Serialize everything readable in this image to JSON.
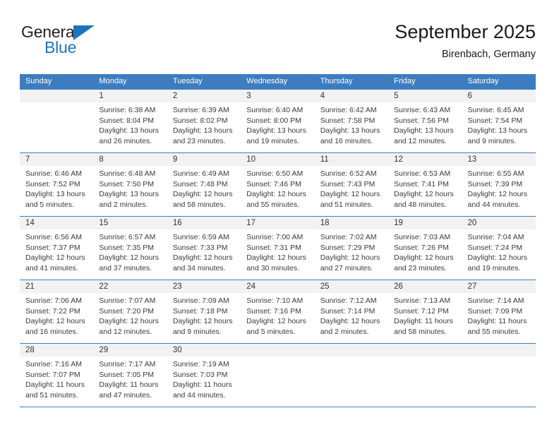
{
  "brand": {
    "name_part1": "General",
    "name_part2": "Blue",
    "accent_color": "#1b75bb"
  },
  "header": {
    "title": "September 2025",
    "subtitle": "Birenbach, Germany"
  },
  "calendar": {
    "header_bg": "#3d7dbf",
    "daynum_bg": "#f2f2f2",
    "labels": {
      "sunrise": "Sunrise:",
      "sunset": "Sunset:",
      "daylight": "Daylight:"
    },
    "weekdays": [
      "Sunday",
      "Monday",
      "Tuesday",
      "Wednesday",
      "Thursday",
      "Friday",
      "Saturday"
    ],
    "weeks": [
      [
        {
          "empty": true
        },
        {
          "day": "1",
          "sunrise": "Sunrise: 6:38 AM",
          "sunset": "Sunset: 8:04 PM",
          "daylight_line1": "Daylight: 13 hours",
          "daylight_line2": "and 26 minutes."
        },
        {
          "day": "2",
          "sunrise": "Sunrise: 6:39 AM",
          "sunset": "Sunset: 8:02 PM",
          "daylight_line1": "Daylight: 13 hours",
          "daylight_line2": "and 23 minutes."
        },
        {
          "day": "3",
          "sunrise": "Sunrise: 6:40 AM",
          "sunset": "Sunset: 8:00 PM",
          "daylight_line1": "Daylight: 13 hours",
          "daylight_line2": "and 19 minutes."
        },
        {
          "day": "4",
          "sunrise": "Sunrise: 6:42 AM",
          "sunset": "Sunset: 7:58 PM",
          "daylight_line1": "Daylight: 13 hours",
          "daylight_line2": "and 16 minutes."
        },
        {
          "day": "5",
          "sunrise": "Sunrise: 6:43 AM",
          "sunset": "Sunset: 7:56 PM",
          "daylight_line1": "Daylight: 13 hours",
          "daylight_line2": "and 12 minutes."
        },
        {
          "day": "6",
          "sunrise": "Sunrise: 6:45 AM",
          "sunset": "Sunset: 7:54 PM",
          "daylight_line1": "Daylight: 13 hours",
          "daylight_line2": "and 9 minutes."
        }
      ],
      [
        {
          "day": "7",
          "sunrise": "Sunrise: 6:46 AM",
          "sunset": "Sunset: 7:52 PM",
          "daylight_line1": "Daylight: 13 hours",
          "daylight_line2": "and 5 minutes."
        },
        {
          "day": "8",
          "sunrise": "Sunrise: 6:48 AM",
          "sunset": "Sunset: 7:50 PM",
          "daylight_line1": "Daylight: 13 hours",
          "daylight_line2": "and 2 minutes."
        },
        {
          "day": "9",
          "sunrise": "Sunrise: 6:49 AM",
          "sunset": "Sunset: 7:48 PM",
          "daylight_line1": "Daylight: 12 hours",
          "daylight_line2": "and 58 minutes."
        },
        {
          "day": "10",
          "sunrise": "Sunrise: 6:50 AM",
          "sunset": "Sunset: 7:46 PM",
          "daylight_line1": "Daylight: 12 hours",
          "daylight_line2": "and 55 minutes."
        },
        {
          "day": "11",
          "sunrise": "Sunrise: 6:52 AM",
          "sunset": "Sunset: 7:43 PM",
          "daylight_line1": "Daylight: 12 hours",
          "daylight_line2": "and 51 minutes."
        },
        {
          "day": "12",
          "sunrise": "Sunrise: 6:53 AM",
          "sunset": "Sunset: 7:41 PM",
          "daylight_line1": "Daylight: 12 hours",
          "daylight_line2": "and 48 minutes."
        },
        {
          "day": "13",
          "sunrise": "Sunrise: 6:55 AM",
          "sunset": "Sunset: 7:39 PM",
          "daylight_line1": "Daylight: 12 hours",
          "daylight_line2": "and 44 minutes."
        }
      ],
      [
        {
          "day": "14",
          "sunrise": "Sunrise: 6:56 AM",
          "sunset": "Sunset: 7:37 PM",
          "daylight_line1": "Daylight: 12 hours",
          "daylight_line2": "and 41 minutes."
        },
        {
          "day": "15",
          "sunrise": "Sunrise: 6:57 AM",
          "sunset": "Sunset: 7:35 PM",
          "daylight_line1": "Daylight: 12 hours",
          "daylight_line2": "and 37 minutes."
        },
        {
          "day": "16",
          "sunrise": "Sunrise: 6:59 AM",
          "sunset": "Sunset: 7:33 PM",
          "daylight_line1": "Daylight: 12 hours",
          "daylight_line2": "and 34 minutes."
        },
        {
          "day": "17",
          "sunrise": "Sunrise: 7:00 AM",
          "sunset": "Sunset: 7:31 PM",
          "daylight_line1": "Daylight: 12 hours",
          "daylight_line2": "and 30 minutes."
        },
        {
          "day": "18",
          "sunrise": "Sunrise: 7:02 AM",
          "sunset": "Sunset: 7:29 PM",
          "daylight_line1": "Daylight: 12 hours",
          "daylight_line2": "and 27 minutes."
        },
        {
          "day": "19",
          "sunrise": "Sunrise: 7:03 AM",
          "sunset": "Sunset: 7:26 PM",
          "daylight_line1": "Daylight: 12 hours",
          "daylight_line2": "and 23 minutes."
        },
        {
          "day": "20",
          "sunrise": "Sunrise: 7:04 AM",
          "sunset": "Sunset: 7:24 PM",
          "daylight_line1": "Daylight: 12 hours",
          "daylight_line2": "and 19 minutes."
        }
      ],
      [
        {
          "day": "21",
          "sunrise": "Sunrise: 7:06 AM",
          "sunset": "Sunset: 7:22 PM",
          "daylight_line1": "Daylight: 12 hours",
          "daylight_line2": "and 16 minutes."
        },
        {
          "day": "22",
          "sunrise": "Sunrise: 7:07 AM",
          "sunset": "Sunset: 7:20 PM",
          "daylight_line1": "Daylight: 12 hours",
          "daylight_line2": "and 12 minutes."
        },
        {
          "day": "23",
          "sunrise": "Sunrise: 7:09 AM",
          "sunset": "Sunset: 7:18 PM",
          "daylight_line1": "Daylight: 12 hours",
          "daylight_line2": "and 9 minutes."
        },
        {
          "day": "24",
          "sunrise": "Sunrise: 7:10 AM",
          "sunset": "Sunset: 7:16 PM",
          "daylight_line1": "Daylight: 12 hours",
          "daylight_line2": "and 5 minutes."
        },
        {
          "day": "25",
          "sunrise": "Sunrise: 7:12 AM",
          "sunset": "Sunset: 7:14 PM",
          "daylight_line1": "Daylight: 12 hours",
          "daylight_line2": "and 2 minutes."
        },
        {
          "day": "26",
          "sunrise": "Sunrise: 7:13 AM",
          "sunset": "Sunset: 7:12 PM",
          "daylight_line1": "Daylight: 11 hours",
          "daylight_line2": "and 58 minutes."
        },
        {
          "day": "27",
          "sunrise": "Sunrise: 7:14 AM",
          "sunset": "Sunset: 7:09 PM",
          "daylight_line1": "Daylight: 11 hours",
          "daylight_line2": "and 55 minutes."
        }
      ],
      [
        {
          "day": "28",
          "sunrise": "Sunrise: 7:16 AM",
          "sunset": "Sunset: 7:07 PM",
          "daylight_line1": "Daylight: 11 hours",
          "daylight_line2": "and 51 minutes."
        },
        {
          "day": "29",
          "sunrise": "Sunrise: 7:17 AM",
          "sunset": "Sunset: 7:05 PM",
          "daylight_line1": "Daylight: 11 hours",
          "daylight_line2": "and 47 minutes."
        },
        {
          "day": "30",
          "sunrise": "Sunrise: 7:19 AM",
          "sunset": "Sunset: 7:03 PM",
          "daylight_line1": "Daylight: 11 hours",
          "daylight_line2": "and 44 minutes."
        },
        {
          "empty": true
        },
        {
          "empty": true
        },
        {
          "empty": true
        },
        {
          "empty": true
        }
      ]
    ]
  }
}
